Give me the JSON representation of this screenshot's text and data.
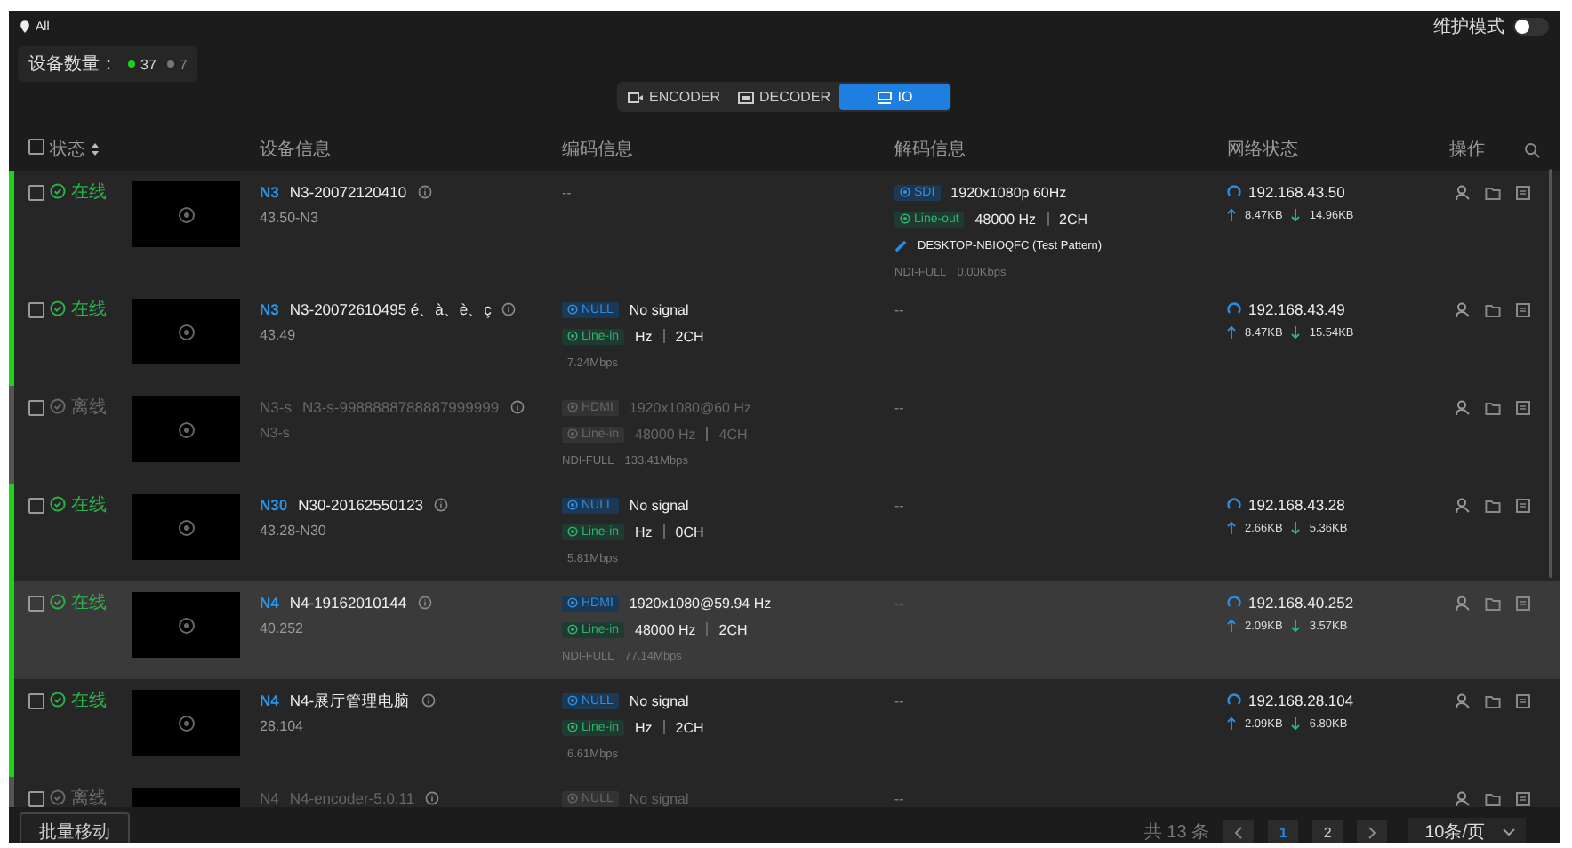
{
  "top": {
    "filter": "All",
    "maintenance": {
      "label": "维护模式",
      "on": false
    },
    "counts": {
      "label": "设备数量：",
      "online": "37",
      "offline": "7"
    }
  },
  "tabs": [
    {
      "label": "ENCODER",
      "selected": false
    },
    {
      "label": "DECODER",
      "selected": false
    },
    {
      "label": "IO",
      "selected": true
    }
  ],
  "table": {
    "columns": [
      "状态",
      "设备信息",
      "编码信息",
      "解码信息",
      "网络状态",
      "操作"
    ],
    "all_checked": false,
    "rows": [
      {
        "checked": false,
        "online": true,
        "status_label": "在线",
        "highlighted": false,
        "model": "N3",
        "name": "N3-20072120410",
        "address": "43.50-N3",
        "encode": [
          {
            "kind": "text",
            "text": "--"
          }
        ],
        "decode": [
          {
            "kind": "video",
            "tag": "SDI",
            "value": "1920x1080p 60Hz"
          },
          {
            "kind": "audio",
            "tag": "Line-out",
            "values": [
              "48000 Hz",
              "2CH"
            ]
          },
          {
            "kind": "source",
            "text": "DESKTOP-NBIOQFC (Test Pattern)"
          },
          {
            "kind": "stream",
            "protocol": "NDI-FULL",
            "rate": "0.00Kbps"
          }
        ],
        "network": {
          "ip": "192.168.43.50",
          "up": "8.47KB",
          "down": "14.96KB"
        }
      },
      {
        "checked": false,
        "online": true,
        "status_label": "在线",
        "highlighted": false,
        "model": "N3",
        "name": "N3-20072610495 é、à、è、ç",
        "address": "43.49",
        "encode": [
          {
            "kind": "video",
            "tag": "NULL",
            "value": "No signal"
          },
          {
            "kind": "audio",
            "tag": "Line-in",
            "values": [
              "Hz",
              "2CH"
            ]
          },
          {
            "kind": "stream",
            "rate": "7.24Mbps"
          }
        ],
        "decode": [
          {
            "kind": "text",
            "text": "--"
          }
        ],
        "network": {
          "ip": "192.168.43.49",
          "up": "8.47KB",
          "down": "15.54KB"
        }
      },
      {
        "checked": false,
        "online": false,
        "status_label": "离线",
        "highlighted": false,
        "model": "N3-s",
        "name": "N3-s-9988888788887999999",
        "address": "N3-s",
        "encode": [
          {
            "kind": "video",
            "tag": "HDMI",
            "value": "1920x1080@60 Hz"
          },
          {
            "kind": "audio",
            "tag": "Line-in",
            "values": [
              "48000 Hz",
              "4CH"
            ]
          },
          {
            "kind": "stream",
            "protocol": "NDI-FULL",
            "rate": "133.41Mbps"
          }
        ],
        "decode": [
          {
            "kind": "text",
            "text": "--"
          }
        ]
      },
      {
        "checked": false,
        "online": true,
        "status_label": "在线",
        "highlighted": false,
        "model": "N30",
        "name": "N30-20162550123",
        "address": "43.28-N30",
        "encode": [
          {
            "kind": "video",
            "tag": "NULL",
            "value": "No signal"
          },
          {
            "kind": "audio",
            "tag": "Line-in",
            "values": [
              "Hz",
              "0CH"
            ]
          },
          {
            "kind": "stream",
            "rate": "5.81Mbps"
          }
        ],
        "decode": [
          {
            "kind": "text",
            "text": "--"
          }
        ],
        "network": {
          "ip": "192.168.43.28",
          "up": "2.66KB",
          "down": "5.36KB"
        }
      },
      {
        "checked": false,
        "online": true,
        "status_label": "在线",
        "highlighted": true,
        "model": "N4",
        "name": "N4-19162010144",
        "address": "40.252",
        "encode": [
          {
            "kind": "video",
            "tag": "HDMI",
            "value": "1920x1080@59.94 Hz"
          },
          {
            "kind": "audio",
            "tag": "Line-in",
            "values": [
              "48000 Hz",
              "2CH"
            ]
          },
          {
            "kind": "stream",
            "protocol": "NDI-FULL",
            "rate": "77.14Mbps"
          }
        ],
        "decode": [
          {
            "kind": "text",
            "text": "--"
          }
        ],
        "network": {
          "ip": "192.168.40.252",
          "up": "2.09KB",
          "down": "3.57KB"
        }
      },
      {
        "checked": false,
        "online": true,
        "status_label": "在线",
        "highlighted": false,
        "model": "N4",
        "name": "N4-展厅管理电脑",
        "address": "28.104",
        "encode": [
          {
            "kind": "video",
            "tag": "NULL",
            "value": "No signal"
          },
          {
            "kind": "audio",
            "tag": "Line-in",
            "values": [
              "Hz",
              "2CH"
            ]
          },
          {
            "kind": "stream",
            "rate": "6.61Mbps"
          }
        ],
        "decode": [
          {
            "kind": "text",
            "text": "--"
          }
        ],
        "network": {
          "ip": "192.168.28.104",
          "up": "2.09KB",
          "down": "6.80KB"
        }
      },
      {
        "checked": false,
        "online": false,
        "status_label": "离线",
        "highlighted": false,
        "model": "N4",
        "name": "N4-encoder-5.0.11",
        "encode": [
          {
            "kind": "video",
            "tag": "NULL",
            "value": "No signal"
          }
        ],
        "decode": [
          {
            "kind": "text",
            "text": "--"
          }
        ]
      }
    ]
  },
  "footer": {
    "batch_button": "批量移动",
    "total": "共 13 条",
    "pages": [
      {
        "label": "1",
        "selected": true
      },
      {
        "label": "2",
        "selected": false
      }
    ],
    "page_size": "10条/页"
  }
}
